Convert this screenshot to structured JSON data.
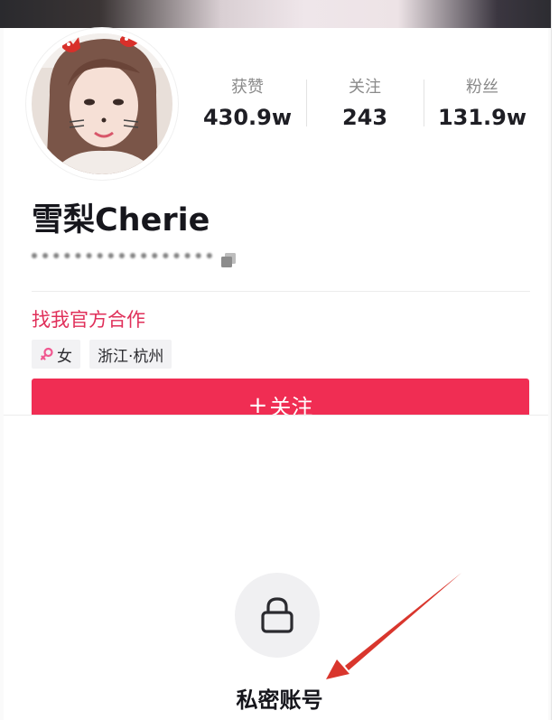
{
  "profile": {
    "name": "雪梨Cherie",
    "cooperation_link": "找我官方合作"
  },
  "stats": [
    {
      "label": "获赞",
      "value": "430.9w"
    },
    {
      "label": "关注",
      "value": "243"
    },
    {
      "label": "粉丝",
      "value": "131.9w"
    }
  ],
  "tags": {
    "gender": "女",
    "gender_icon": "female-icon",
    "location": "浙江·杭州"
  },
  "actions": {
    "follow_plus": "+",
    "follow_label": "关注"
  },
  "privacy": {
    "lock_icon": "lock-icon",
    "label": "私密账号"
  },
  "colors": {
    "accent": "#f02d53",
    "link": "#e0305a",
    "annotation_arrow": "#d9362d"
  }
}
